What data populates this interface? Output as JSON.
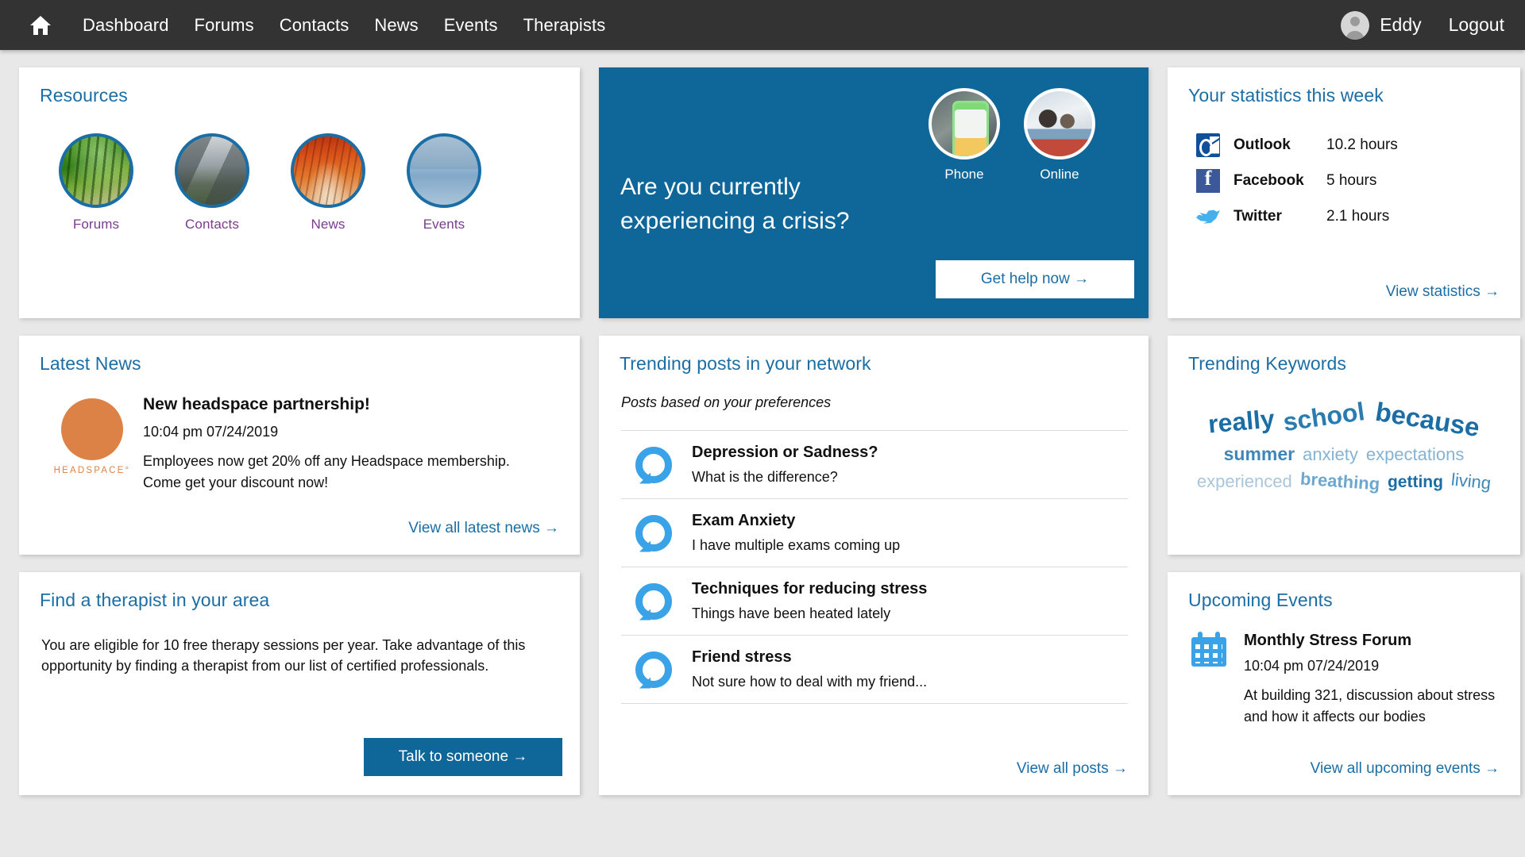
{
  "navbar": {
    "home_icon": "home-icon",
    "links": [
      "Dashboard",
      "Forums",
      "Contacts",
      "News",
      "Events",
      "Therapists"
    ],
    "user": "Eddy",
    "logout": "Logout"
  },
  "resources": {
    "title": "Resources",
    "items": [
      {
        "label": "Forums",
        "image": "forest-path-photo"
      },
      {
        "label": "Contacts",
        "image": "mountain-lake-photo"
      },
      {
        "label": "News",
        "image": "autumn-forest-photo"
      },
      {
        "label": "Events",
        "image": "misty-lake-photo"
      }
    ]
  },
  "crisis": {
    "headline_line1": "Are you currently",
    "headline_line2": "experiencing a crisis?",
    "options": [
      {
        "label": "Phone",
        "image": "hand-holding-phone-photo"
      },
      {
        "label": "Online",
        "image": "call-center-agents-photo"
      }
    ],
    "button": "Get help now  →",
    "bg_color": "#0f6698"
  },
  "statistics": {
    "title": "Your statistics this week",
    "rows": [
      {
        "icon": "outlook-icon",
        "name": "Outlook",
        "value": "10.2 hours"
      },
      {
        "icon": "facebook-icon",
        "name": "Facebook",
        "value": "5 hours"
      },
      {
        "icon": "twitter-icon",
        "name": "Twitter",
        "value": "2.1 hours"
      }
    ],
    "link": "View statistics  →"
  },
  "latest_news": {
    "title": "Latest News",
    "logo_text": "HEADSPACE°",
    "logo_color": "#dd8246",
    "item": {
      "title": "New headspace partnership!",
      "date": "10:04 pm 07/24/2019",
      "desc_line1": "Employees now get 20% off any Headspace membership.",
      "desc_line2": "Come get your discount now!"
    },
    "link": "View all latest news  →"
  },
  "trending_posts": {
    "title": "Trending posts in your network",
    "subtitle": "Posts based on your preferences",
    "posts": [
      {
        "title": "Depression or Sadness?",
        "sub": "What is the difference?"
      },
      {
        "title": "Exam Anxiety",
        "sub": "I have multiple exams coming up"
      },
      {
        "title": "Techniques for reducing stress",
        "sub": "Things have been heated lately"
      },
      {
        "title": "Friend stress",
        "sub": "Not sure how to deal with my friend..."
      }
    ],
    "link": "View all posts  →"
  },
  "trending_keywords": {
    "title": "Trending Keywords",
    "words": [
      "really",
      "school",
      "because",
      "summer",
      "anxiety",
      "expectations",
      "experienced",
      "breathing",
      "getting",
      "living"
    ]
  },
  "upcoming_events": {
    "title": "Upcoming Events",
    "icon": "calendar-icon",
    "item": {
      "title": "Monthly Stress Forum",
      "date": "10:04 pm 07/24/2019",
      "desc_line1": "At building 321, discussion about stress",
      "desc_line2": "and how it affects our bodies"
    },
    "link": "View all upcoming events  →"
  },
  "therapist": {
    "title": "Find a therapist in your area",
    "text_line1": "You are eligible for 10 free therapy sessions per year. Take advantage of this",
    "text_line2": "opportunity by finding a therapist from our list of certified professionals.",
    "button": "Talk to someone  →"
  }
}
